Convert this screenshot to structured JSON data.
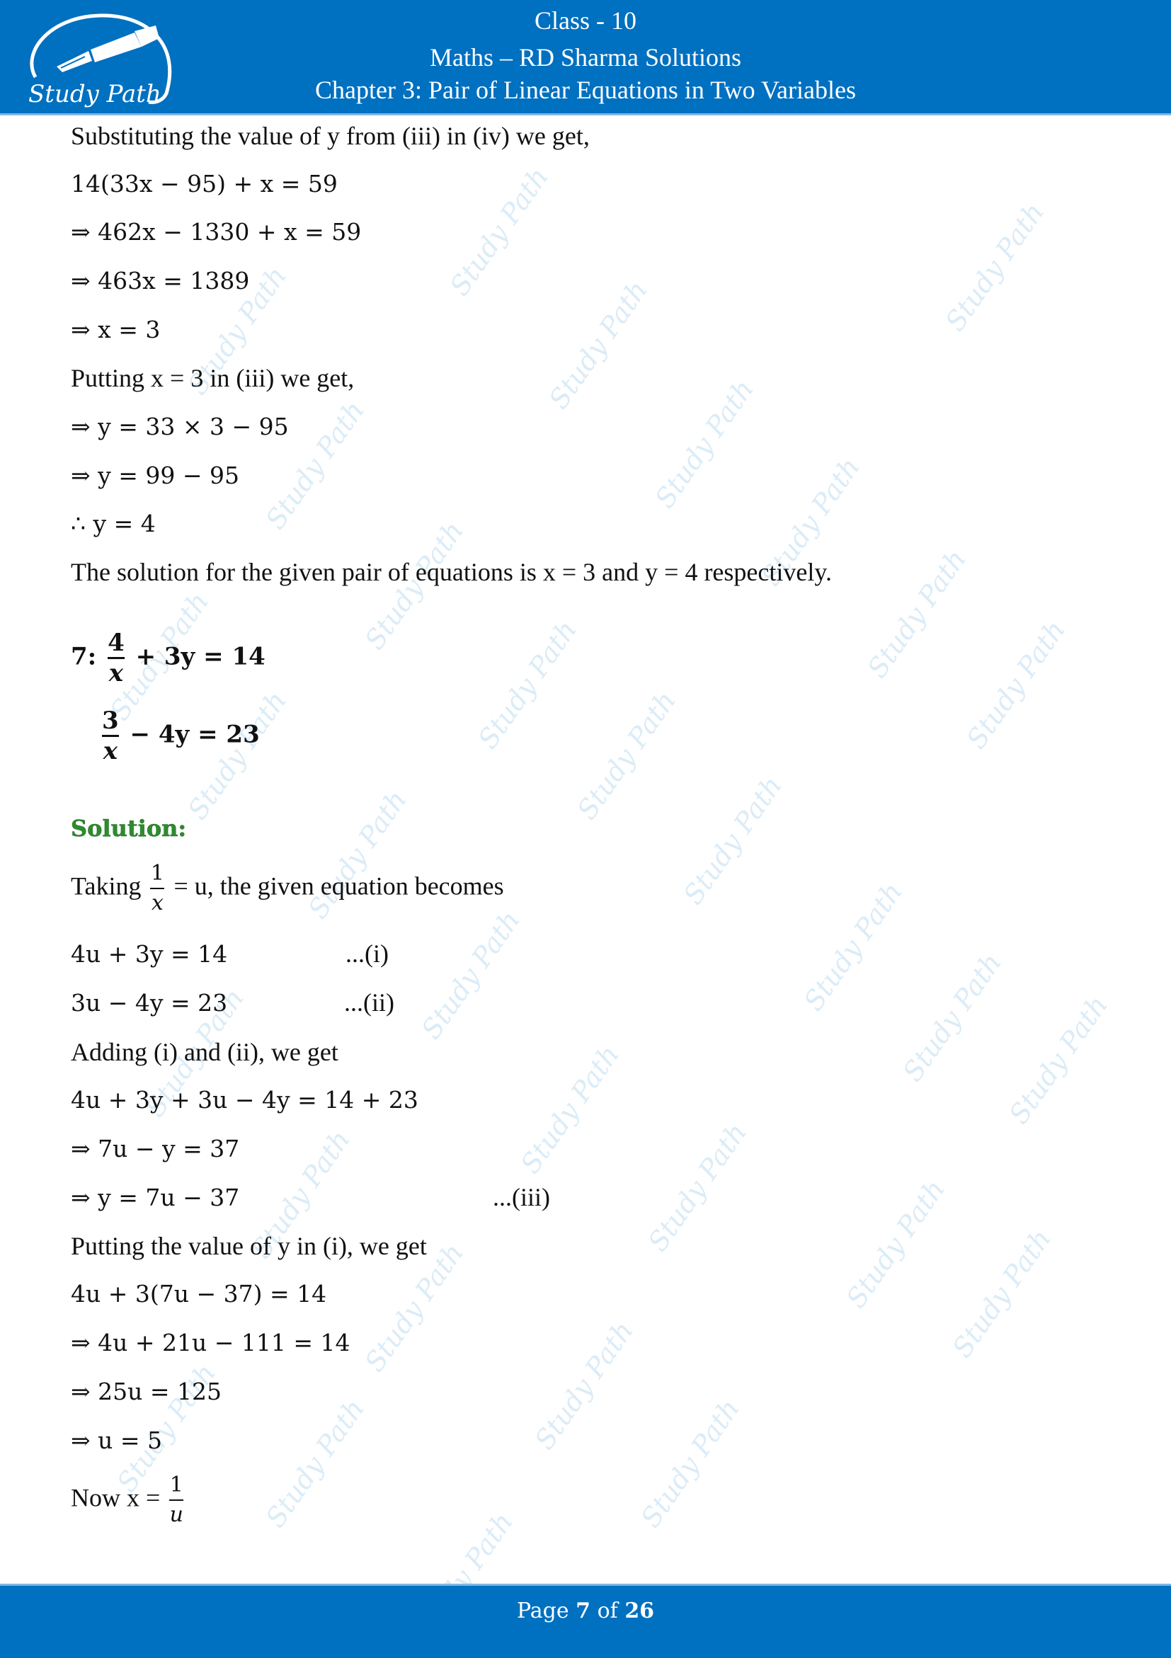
{
  "header": {
    "class_label": "Class - 10",
    "subject": "Maths – RD Sharma Solutions",
    "chapter": "Chapter 3: Pair of Linear Equations in Two Variables",
    "logo_text": "Study Path",
    "brand_color": "#0070c0"
  },
  "watermark_text": "Study Path",
  "content": {
    "part1": [
      "Substituting the value of y from (iii) in (iv) we get,",
      "14(33x − 95) + x = 59",
      "⇒ 462x − 1330 + x = 59",
      "⇒ 463x = 1389",
      "⇒ x = 3",
      "Putting x = 3 in (iii) we get,",
      "⇒ y = 33 × 3 − 95",
      "⇒ y = 99 − 95",
      "∴ y = 4",
      "The solution for the given pair of equations is x = 3 and y = 4 respectively."
    ],
    "question": {
      "number": "7:",
      "eq1": {
        "num": "4",
        "den": "x",
        "rest": "+ 3y = 14"
      },
      "eq2": {
        "num": "3",
        "den": "x",
        "rest": "− 4y = 23"
      }
    },
    "solution_label": "Solution:",
    "taking": {
      "prefix": "Taking",
      "num": "1",
      "den": "x",
      "suffix": "= u, the given equation becomes"
    },
    "eq_i": {
      "text": "4u + 3y = 14",
      "tag": "...(i)"
    },
    "eq_ii": {
      "text": "3u − 4y = 23",
      "tag": "...(ii)"
    },
    "part2": [
      "Adding (i) and (ii), we get",
      "4u + 3y + 3u − 4y = 14 + 23",
      "⇒ 7u − y = 37"
    ],
    "eq_iii": {
      "text": "⇒ y = 7u − 37",
      "tag": "...(iii)"
    },
    "part3": [
      "Putting the value of y in (i), we get",
      "4u + 3(7u − 37) = 14",
      "⇒ 4u + 21u − 111 = 14",
      "⇒  25u = 125",
      "⇒ u = 5"
    ],
    "now": {
      "prefix": "Now  x =",
      "num": "1",
      "den": "u"
    }
  },
  "footer": {
    "page_word": "Page",
    "current_page": "7",
    "of_word": "of",
    "total_pages": "26"
  }
}
